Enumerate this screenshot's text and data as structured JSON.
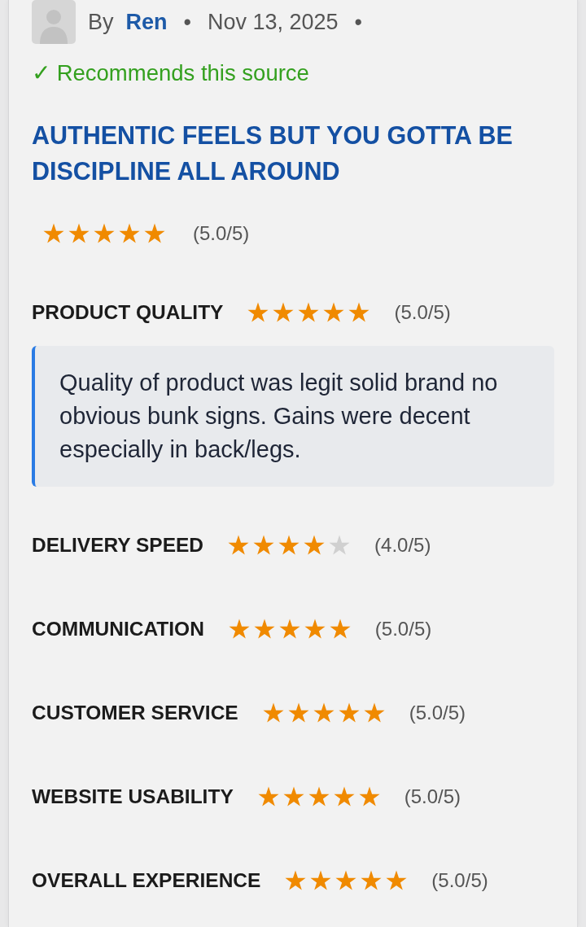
{
  "review": {
    "byline": [
      {
        "kind": "prefix",
        "text": "By"
      },
      {
        "kind": "author",
        "text": "Ren"
      },
      {
        "kind": "separator",
        "text": "•"
      },
      {
        "kind": "date",
        "text": "Nov 13, 2025"
      },
      {
        "kind": "separator",
        "text": "•"
      }
    ],
    "recommendation": "✓ Recommends this source",
    "title": "AUTHENTIC FEELS BUT YOU GOTTA BE DISCIPLINE ALL AROUND",
    "overall": {
      "stars": 5,
      "score": "(5.0/5)"
    },
    "ratings": [
      {
        "label": "PRODUCT QUALITY",
        "stars": 5,
        "score": "(5.0/5)",
        "comment": "Quality of product was legit solid brand no obvious bunk signs. Gains were decent especially in back/legs."
      },
      {
        "label": "DELIVERY SPEED",
        "stars": 4,
        "score": "(4.0/5)"
      },
      {
        "label": "COMMUNICATION",
        "stars": 5,
        "score": "(5.0/5)"
      },
      {
        "label": "CUSTOMER SERVICE",
        "stars": 5,
        "score": "(5.0/5)"
      },
      {
        "label": "WEBSITE USABILITY",
        "stars": 5,
        "score": "(5.0/5)"
      },
      {
        "label": "OVERALL EXPERIENCE",
        "stars": 5,
        "score": "(5.0/5)"
      }
    ]
  }
}
